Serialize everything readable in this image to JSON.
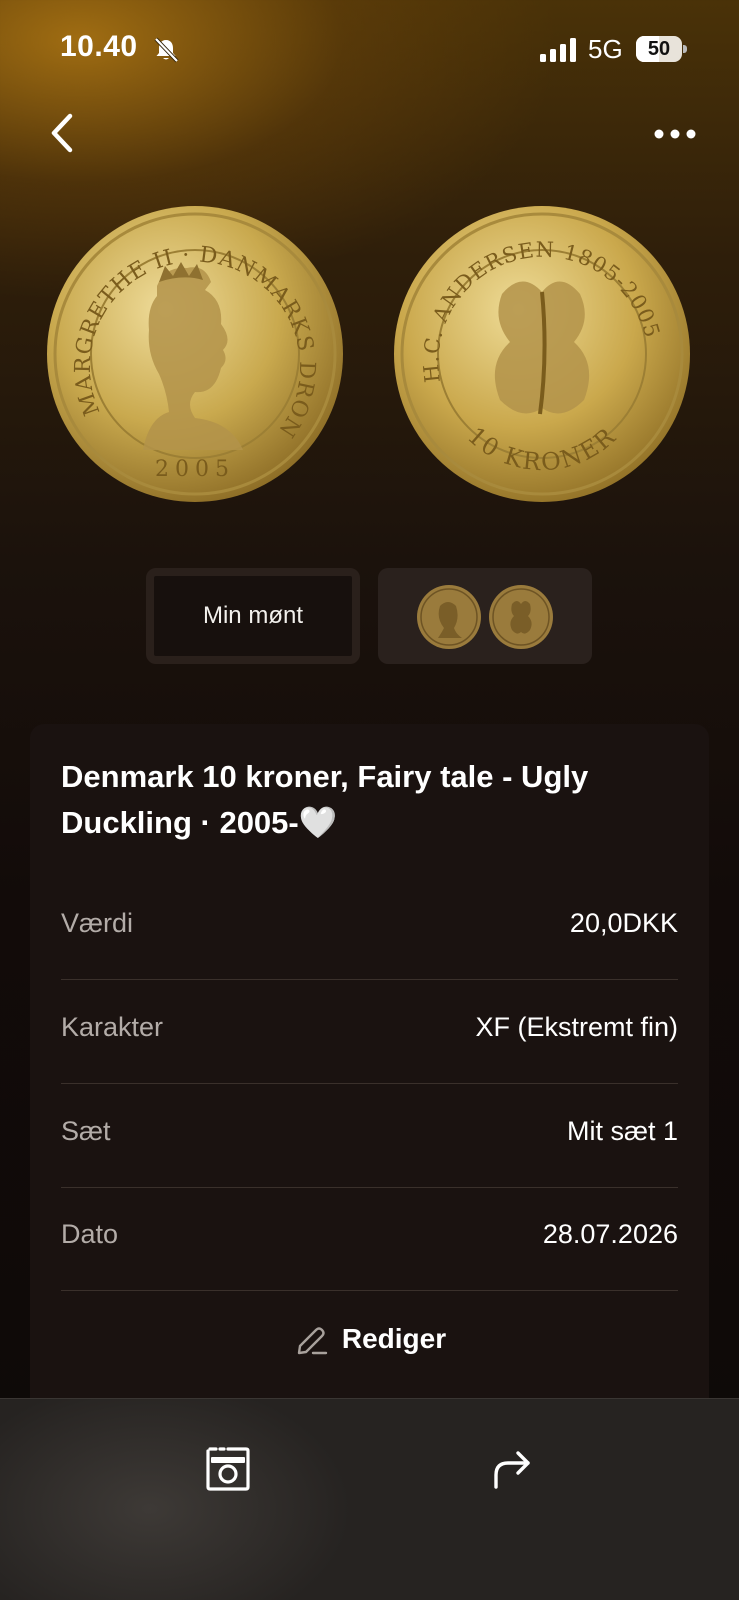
{
  "status_bar": {
    "time": "10.40",
    "network": "5G",
    "battery": "50"
  },
  "icons": {
    "back": "chevron-left-icon",
    "more": "ellipsis-icon",
    "mute": "bell-slash-icon",
    "scan": "camera-frame-icon",
    "share": "share-arrow-icon",
    "edit": "pencil-icon"
  },
  "coin_front_legend": {
    "text": "MARGRETHE II · DANMARKS DRONNING",
    "year": "2005"
  },
  "coin_back_legend": {
    "text": "H.C. ANDERSEN 1805-2005",
    "denomination": "10 KRONER"
  },
  "thumbs": {
    "mine_label": "Min mønt"
  },
  "card": {
    "title": "Denmark 10 kroner, Fairy tale - Ugly Duckling · 2005-🤍",
    "rows": [
      {
        "label": "Værdi",
        "value": "20,0DKK"
      },
      {
        "label": "Karakter",
        "value": "XF (Ekstremt fin)"
      },
      {
        "label": "Sæt",
        "value": "Mit sæt 1"
      },
      {
        "label": "Dato",
        "value": "28.07.2026"
      }
    ],
    "edit_label": "Rediger"
  },
  "colors": {
    "gold": "#c9a94e",
    "card_bg": "#1a1210",
    "bottom_bar": "#262321"
  }
}
